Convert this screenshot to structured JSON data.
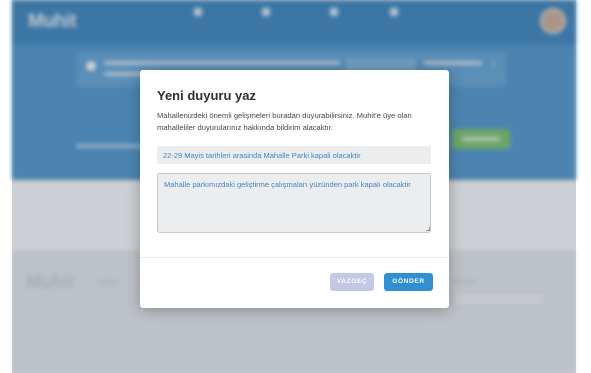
{
  "background": {
    "brand": "Muhit",
    "nav_items": [
      "",
      "",
      "",
      ""
    ],
    "user_name": "",
    "colors": {
      "navbar": "#2277b8",
      "hero": "#3a8cca",
      "accent_green": "#6cc05a"
    }
  },
  "modal": {
    "title": "Yeni duyuru yaz",
    "description": "Mahallenizdeki önemli gelişmeleri buradan duyurabilirsiniz. Muhit'e üye olan mahalleliler duyurularınız hakkında bildirim alacaktır.",
    "title_field": {
      "value": "22-29 Mayis tarihleri arasinda Mahalle Parki kapali olacaktir",
      "placeholder": ""
    },
    "body_field": {
      "value": "Mahalle parkımızdaki geliştirme çalışmaları yüzünden park kapalı olacaktir",
      "placeholder": ""
    },
    "cancel_label": "VAZGEÇ",
    "submit_label": "GÖNDER",
    "colors": {
      "submit": "#2f8fd0",
      "cancel": "#c3c8e6",
      "input_text": "#3f87c4"
    }
  }
}
